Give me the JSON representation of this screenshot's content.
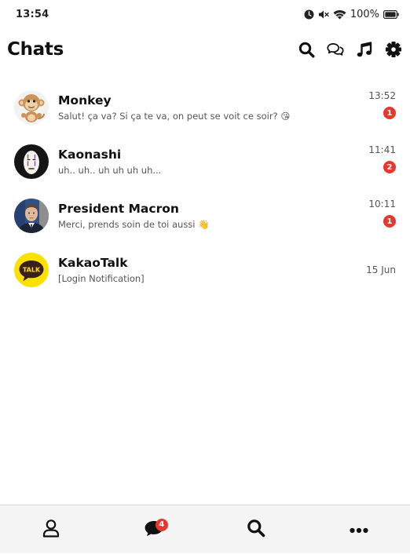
{
  "status_bar": {
    "time": "13:54",
    "battery_text": "100%",
    "icons": [
      "alarm-icon",
      "mute-icon",
      "wifi-icon",
      "battery-icon"
    ]
  },
  "header": {
    "title": "Chats",
    "actions": [
      "search-icon",
      "chat-bubbles-icon",
      "music-icon",
      "gear-icon"
    ]
  },
  "chats": [
    {
      "name": "Monkey",
      "preview": "Salut! ça va? Si ça te va, on peut se voit ce soir? 😘",
      "time": "13:52",
      "unread": "1"
    },
    {
      "name": "Kaonashi",
      "preview": "uh.. uh.. uh uh uh uh...",
      "time": "11:41",
      "unread": "2"
    },
    {
      "name": "President Macron",
      "preview": "Merci, prends soin de toi aussi 👋",
      "time": "10:11",
      "unread": "1"
    },
    {
      "name": "KakaoTalk",
      "preview": "[Login Notification]",
      "time": "15 Jun",
      "unread": null,
      "avatar_text": "TALK"
    }
  ],
  "tab_bar": {
    "tabs": [
      "person-icon",
      "chat-icon",
      "search-icon",
      "more-icon"
    ],
    "chat_badge": "4"
  },
  "colors": {
    "badge": "#e8372c",
    "kakao_yellow": "#fae100",
    "kakao_brown": "#3b1e1e",
    "tab_bar_bg": "#f4f4f4"
  }
}
